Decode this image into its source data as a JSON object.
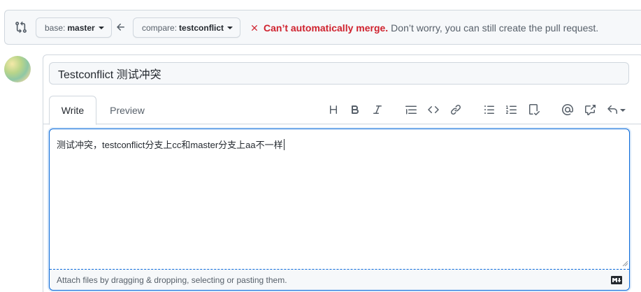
{
  "compare": {
    "base_label": "base:",
    "base_value": "master",
    "compare_label": "compare:",
    "compare_value": "testconflict",
    "merge_status_strong": "Can’t automatically merge.",
    "merge_status_rest": "Don’t worry, you can still create the pull request.",
    "status_color": "#cf222e"
  },
  "pr": {
    "title": "Testconflict 测试冲突",
    "tabs": [
      {
        "label": "Write",
        "active": true
      },
      {
        "label": "Preview",
        "active": false
      }
    ],
    "toolbar": [
      "heading-icon",
      "bold-icon",
      "italic-icon",
      "quote-icon",
      "code-icon",
      "link-icon",
      "unordered-list-icon",
      "ordered-list-icon",
      "task-list-icon",
      "mention-icon",
      "cross-reference-icon",
      "reply-icon"
    ],
    "body": "测试冲突，testconflict分支上cc和master分支上aa不一样",
    "attach_hint": "Attach files by dragging & dropping, selecting or pasting them."
  },
  "colors": {
    "accent": "#0969da",
    "border": "#d0d7de",
    "muted": "#57606a"
  }
}
